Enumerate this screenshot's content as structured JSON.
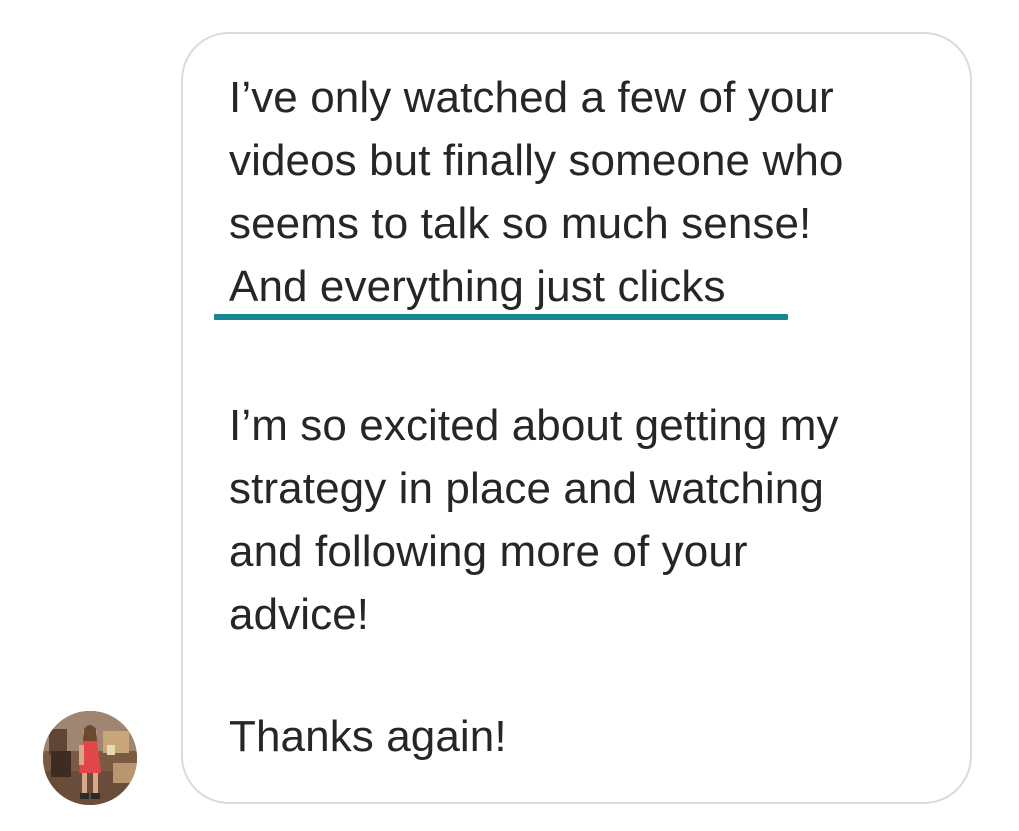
{
  "message": {
    "paragraph1": [
      "I’ve only watched a few of your",
      "videos but finally someone who",
      "seems to talk so much sense!",
      "And everything just clicks"
    ],
    "paragraph2": [
      "I’m so excited about getting my",
      "strategy in place and watching",
      "and following more of your",
      "advice!"
    ],
    "paragraph3": [
      "Thanks again!"
    ],
    "highlight_color": "#17868f"
  },
  "colors": {
    "text": "#262626",
    "bubble_border": "#dbdbdb",
    "background": "#ffffff"
  },
  "avatar": {
    "icon": "user-avatar"
  }
}
